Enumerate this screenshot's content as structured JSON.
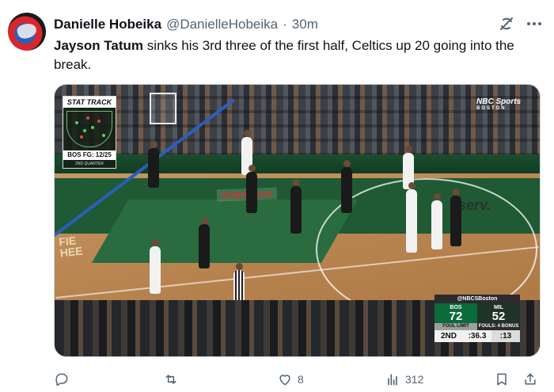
{
  "author": {
    "display_name": "Danielle Hobeika",
    "handle": "@DanielleHobeika",
    "separator": "·",
    "time": "30m"
  },
  "post": {
    "text_lead": "Jayson Tatum",
    "text_rest": " sinks his 3rd three of the first half, Celtics up 20 going into the break."
  },
  "video": {
    "stat_track_title": "STAT TRACK",
    "stat_line": "BOS FG: 12/25",
    "stat_sub": "2ND QUARTER",
    "network_logo": "NBC Sports",
    "network_sub": "BOSTON",
    "floor_ad": "StateFarm",
    "floor_brand": "serv.",
    "court_words": [
      "FIE",
      "HEE"
    ],
    "scorebug": {
      "source": "@NBCSBoston",
      "home_abbr": "BOS",
      "home_score": "72",
      "away_abbr": "MIL",
      "away_score": "52",
      "home_fouls": "FOUL LIMIT",
      "away_fouls": "FOULS: 4 BONUS",
      "period": "2ND",
      "clock": ":36.3",
      "shot_clock": ":13"
    }
  },
  "actions": {
    "reply_count": "",
    "repost_count": "",
    "like_count": "8",
    "views_count": "312"
  },
  "icons": [
    "avatar",
    "grok-icon",
    "more-icon",
    "reply-icon",
    "repost-icon",
    "like-icon",
    "views-icon",
    "bookmark-icon",
    "share-icon"
  ]
}
